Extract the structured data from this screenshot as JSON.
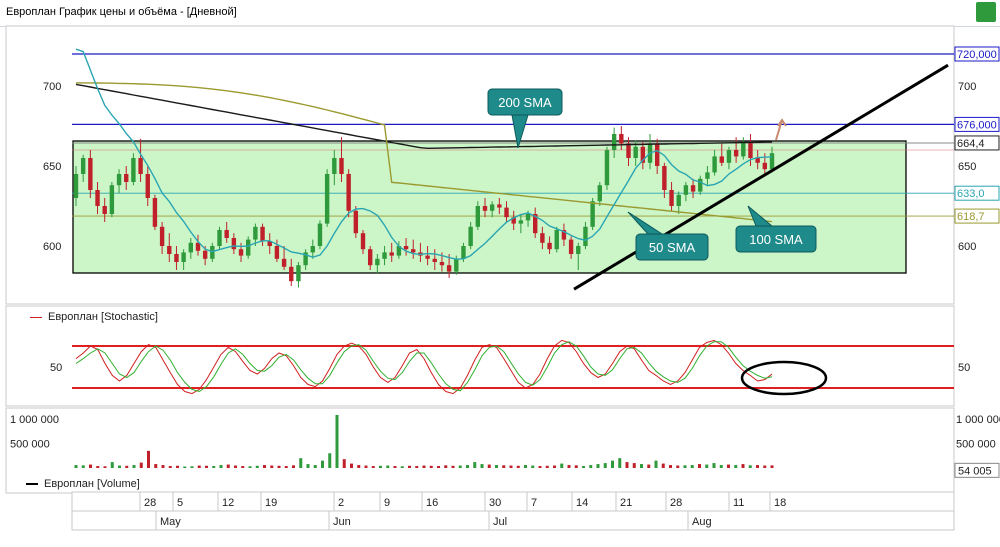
{
  "window": {
    "title": "Европлан График цены и объёма - [Дневной]"
  },
  "price_pane": {
    "y_ticks": [
      600,
      650,
      700
    ],
    "marker_labels": [
      {
        "text": "720,000",
        "value": 720,
        "color": "#1a1ac8"
      },
      {
        "text": "676,000",
        "value": 676,
        "color": "#1a1ac8"
      },
      {
        "text": "664,4",
        "value": 664.4,
        "color": "#222222"
      },
      {
        "text": "633,0",
        "value": 633,
        "color": "#2aa6b3"
      },
      {
        "text": "618,7",
        "value": 618.7,
        "color": "#9a9a30"
      }
    ],
    "annotations": {
      "sma200": "200 SMA",
      "sma50": "50 SMA",
      "sma100": "100 SMA"
    }
  },
  "stoch_pane": {
    "legend": "Европлан [Stochastic]",
    "tick_left": "50",
    "tick_right": "50"
  },
  "volume_pane": {
    "legend": "Европлан [Volume]",
    "left_ticks": [
      "1 000 000",
      "500 000"
    ],
    "right_ticks": [
      "1 000 000",
      "500 000"
    ],
    "last_label": "54 005"
  },
  "x_axis": {
    "day_ticks": [
      "28",
      "5",
      "12",
      "19",
      "2",
      "9",
      "16",
      "30",
      "7",
      "14",
      "21",
      "28",
      "11",
      "18"
    ],
    "month_labels": [
      "May",
      "Jun",
      "Jul",
      "Aug"
    ]
  },
  "colors": {
    "up": "#2e9a3b",
    "down": "#c0202a",
    "sma50": "#2aa6b3",
    "sma100": "#9a9a30",
    "sma200": "#1a1a1a",
    "hline": "#1a1ac8",
    "box_fill": "#ccf5c8",
    "annotation_fill": "#1f8a8a",
    "stoch_k": "#d02020",
    "stoch_d": "#30b030"
  },
  "chart_data": [
    {
      "type": "candlestick",
      "title": "",
      "ylim": [
        565,
        735
      ],
      "grid": false,
      "x_labels": [
        "28",
        "5",
        "12",
        "19",
        "2",
        "9",
        "16",
        "30",
        "7",
        "14",
        "21",
        "28",
        "11",
        "18"
      ],
      "ohlc": [
        [
          630,
          650,
          625,
          645
        ],
        [
          645,
          657,
          640,
          655
        ],
        [
          655,
          660,
          630,
          635
        ],
        [
          635,
          640,
          620,
          625
        ],
        [
          625,
          630,
          615,
          620
        ],
        [
          620,
          640,
          618,
          638
        ],
        [
          638,
          648,
          633,
          645
        ],
        [
          645,
          650,
          635,
          640
        ],
        [
          640,
          658,
          638,
          655
        ],
        [
          655,
          667,
          640,
          645
        ],
        [
          645,
          650,
          625,
          630
        ],
        [
          630,
          632,
          610,
          612
        ],
        [
          612,
          615,
          595,
          600
        ],
        [
          600,
          608,
          590,
          595
        ],
        [
          595,
          600,
          585,
          590
        ],
        [
          590,
          598,
          585,
          596
        ],
        [
          596,
          605,
          592,
          602
        ],
        [
          602,
          607,
          594,
          597
        ],
        [
          597,
          600,
          588,
          592
        ],
        [
          592,
          602,
          590,
          600
        ],
        [
          600,
          612,
          598,
          610
        ],
        [
          610,
          615,
          602,
          605
        ],
        [
          605,
          608,
          595,
          598
        ],
        [
          598,
          602,
          590,
          594
        ],
        [
          594,
          606,
          592,
          604
        ],
        [
          604,
          614,
          600,
          612
        ],
        [
          612,
          614,
          600,
          603
        ],
        [
          603,
          608,
          595,
          600
        ],
        [
          600,
          604,
          590,
          592
        ],
        [
          592,
          600,
          585,
          587
        ],
        [
          587,
          592,
          575,
          578
        ],
        [
          578,
          590,
          574,
          588
        ],
        [
          588,
          598,
          585,
          596
        ],
        [
          596,
          604,
          592,
          600
        ],
        [
          600,
          616,
          598,
          614
        ],
        [
          614,
          648,
          612,
          645
        ],
        [
          645,
          660,
          638,
          655
        ],
        [
          655,
          668,
          640,
          645
        ],
        [
          645,
          648,
          618,
          622
        ],
        [
          622,
          625,
          605,
          608
        ],
        [
          608,
          610,
          595,
          598
        ],
        [
          598,
          600,
          585,
          588
        ],
        [
          588,
          595,
          583,
          592
        ],
        [
          592,
          600,
          588,
          596
        ],
        [
          596,
          602,
          590,
          594
        ],
        [
          594,
          603,
          592,
          600
        ],
        [
          600,
          605,
          594,
          598
        ],
        [
          598,
          604,
          592,
          596
        ],
        [
          596,
          602,
          590,
          594
        ],
        [
          594,
          600,
          588,
          592
        ],
        [
          592,
          598,
          585,
          590
        ],
        [
          590,
          596,
          584,
          588
        ],
        [
          588,
          595,
          580,
          584
        ],
        [
          584,
          594,
          582,
          592
        ],
        [
          592,
          602,
          590,
          600
        ],
        [
          600,
          615,
          598,
          612
        ],
        [
          612,
          628,
          610,
          625
        ],
        [
          625,
          630,
          618,
          622
        ],
        [
          622,
          628,
          618,
          626
        ],
        [
          626,
          630,
          620,
          624
        ],
        [
          624,
          628,
          615,
          618
        ],
        [
          618,
          622,
          610,
          614
        ],
        [
          614,
          620,
          608,
          616
        ],
        [
          616,
          622,
          612,
          620
        ],
        [
          620,
          624,
          605,
          608
        ],
        [
          608,
          612,
          598,
          602
        ],
        [
          602,
          606,
          595,
          598
        ],
        [
          598,
          612,
          596,
          610
        ],
        [
          610,
          614,
          600,
          604
        ],
        [
          604,
          606,
          592,
          595
        ],
        [
          595,
          602,
          585,
          600
        ],
        [
          600,
          615,
          598,
          612
        ],
        [
          612,
          630,
          610,
          628
        ],
        [
          628,
          640,
          625,
          638
        ],
        [
          638,
          662,
          635,
          660
        ],
        [
          660,
          674,
          655,
          670
        ],
        [
          670,
          675,
          660,
          664
        ],
        [
          664,
          668,
          650,
          655
        ],
        [
          655,
          666,
          650,
          662
        ],
        [
          662,
          665,
          648,
          652
        ],
        [
          652,
          670,
          648,
          664
        ],
        [
          664,
          667,
          645,
          650
        ],
        [
          650,
          652,
          630,
          635
        ],
        [
          635,
          640,
          622,
          625
        ],
        [
          625,
          634,
          620,
          632
        ],
        [
          632,
          640,
          628,
          638
        ],
        [
          638,
          642,
          630,
          634
        ],
        [
          634,
          644,
          632,
          642
        ],
        [
          642,
          650,
          638,
          646
        ],
        [
          646,
          660,
          644,
          656
        ],
        [
          656,
          664,
          650,
          652
        ],
        [
          652,
          662,
          648,
          660
        ],
        [
          660,
          668,
          652,
          656
        ],
        [
          656,
          668,
          654,
          665
        ],
        [
          665,
          670,
          650,
          655
        ],
        [
          655,
          660,
          648,
          652
        ],
        [
          652,
          658,
          645,
          648
        ],
        [
          648,
          662,
          646,
          658
        ]
      ]
    },
    {
      "type": "line",
      "title": "Stochastic",
      "ylim": [
        0,
        100
      ],
      "series": [
        {
          "values": [
            62,
            70,
            80,
            75,
            55,
            38,
            30,
            38,
            55,
            72,
            82,
            78,
            60,
            42,
            25,
            15,
            12,
            18,
            32,
            50,
            68,
            78,
            72,
            58,
            45,
            40,
            48,
            62,
            70,
            66,
            52,
            35,
            25,
            22,
            30,
            48,
            68,
            80,
            84,
            80,
            68,
            50,
            35,
            28,
            35,
            52,
            70,
            75,
            62,
            42,
            25,
            15,
            12,
            20,
            38,
            60,
            78,
            82,
            78,
            62,
            45,
            28,
            20,
            25,
            40,
            62,
            80,
            88,
            85,
            72,
            55,
            42,
            35,
            40,
            55,
            72,
            80,
            76,
            60,
            45,
            38,
            30,
            25,
            30,
            42,
            60,
            78,
            85,
            88,
            82,
            70,
            55,
            45,
            38,
            30,
            32,
            40
          ]
        },
        {
          "values": [
            55,
            62,
            70,
            76,
            70,
            55,
            40,
            35,
            42,
            58,
            72,
            80,
            74,
            60,
            42,
            28,
            18,
            15,
            22,
            36,
            54,
            70,
            76,
            68,
            55,
            45,
            44,
            52,
            64,
            68,
            60,
            46,
            34,
            26,
            26,
            38,
            56,
            72,
            80,
            82,
            74,
            58,
            44,
            34,
            32,
            42,
            58,
            70,
            70,
            56,
            40,
            26,
            18,
            16,
            28,
            46,
            66,
            78,
            80,
            72,
            56,
            40,
            28,
            24,
            32,
            50,
            70,
            82,
            86,
            80,
            66,
            50,
            40,
            38,
            46,
            62,
            76,
            78,
            70,
            56,
            44,
            36,
            30,
            28,
            34,
            48,
            66,
            80,
            86,
            86,
            78,
            64,
            52,
            44,
            38,
            34,
            36
          ]
        }
      ]
    },
    {
      "type": "bar",
      "title": "Volume",
      "ylim": [
        0,
        1100000
      ],
      "values": [
        60000,
        55000,
        70000,
        40000,
        35000,
        120000,
        50000,
        45000,
        60000,
        110000,
        350000,
        80000,
        60000,
        40000,
        45000,
        30000,
        35000,
        50000,
        45000,
        40000,
        60000,
        70000,
        50000,
        40000,
        35000,
        45000,
        60000,
        50000,
        45000,
        40000,
        55000,
        200000,
        80000,
        60000,
        150000,
        300000,
        1080000,
        180000,
        90000,
        60000,
        50000,
        40000,
        45000,
        50000,
        40000,
        35000,
        45000,
        40000,
        50000,
        45000,
        40000,
        55000,
        45000,
        50000,
        60000,
        120000,
        80000,
        70000,
        60000,
        55000,
        50000,
        45000,
        60000,
        50000,
        40000,
        45000,
        50000,
        90000,
        60000,
        55000,
        40000,
        60000,
        80000,
        100000,
        150000,
        200000,
        120000,
        100000,
        80000,
        70000,
        150000,
        90000,
        60000,
        50000,
        55000,
        60000,
        80000,
        70000,
        100000,
        60000,
        70000,
        60000,
        80000,
        55000,
        60000,
        50000,
        54005
      ]
    }
  ]
}
